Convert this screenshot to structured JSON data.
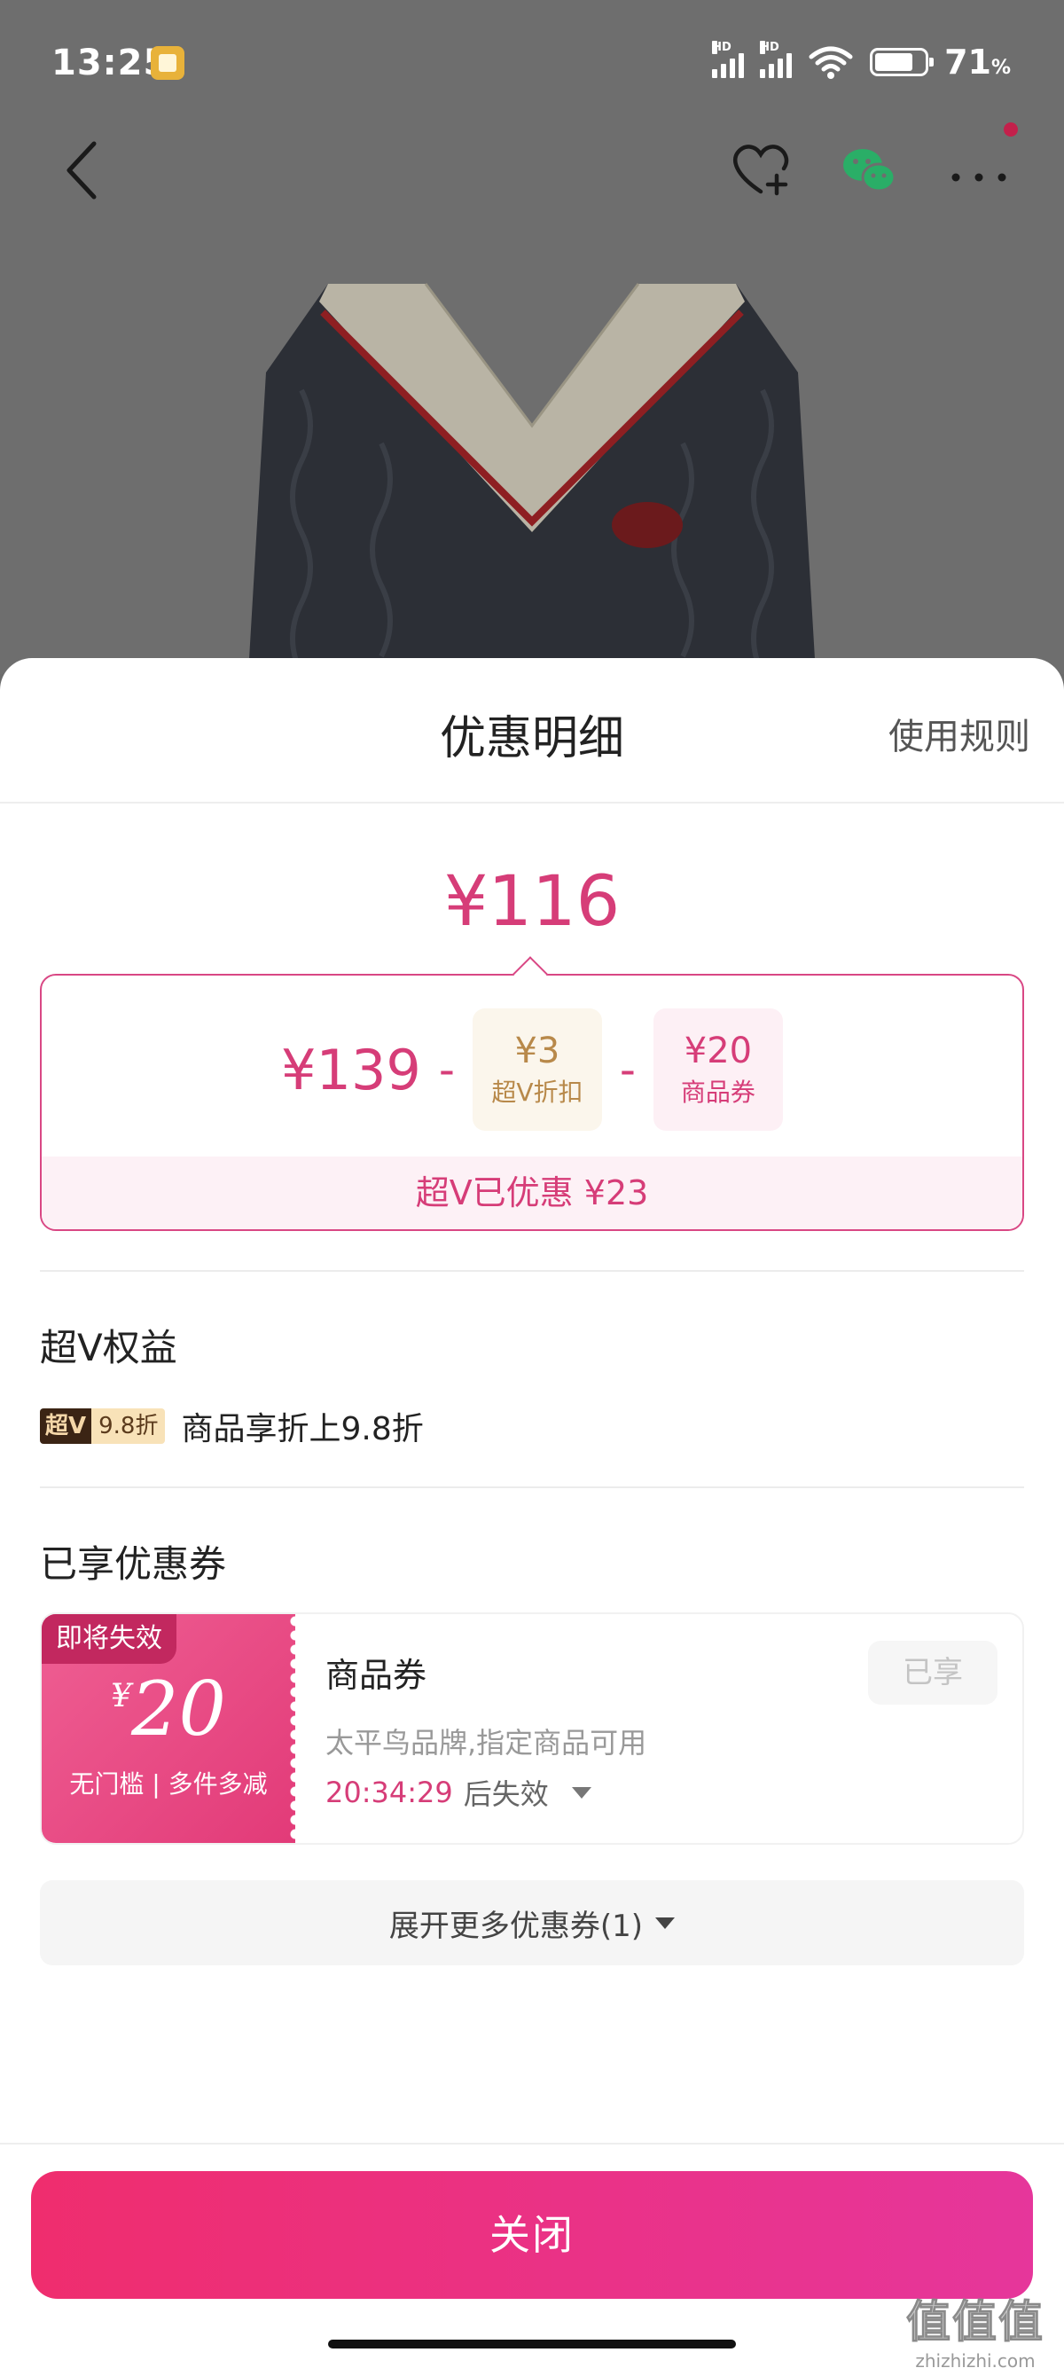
{
  "status_bar": {
    "time": "13:25",
    "signal_1_label": "HD",
    "signal_2_label": "HD",
    "battery_percent": "71",
    "battery_unit": "%",
    "icons": [
      "notification-icon",
      "signal-icon",
      "signal-icon",
      "wifi-icon",
      "battery-icon"
    ]
  },
  "nav": {
    "icons": [
      "back-icon",
      "favorite-add-icon",
      "wechat-icon",
      "more-icon"
    ],
    "wechat_color": "#2aae67",
    "badge_color": "#c3204b"
  },
  "sheet": {
    "title": "优惠明细",
    "rules_link": "使用规则",
    "final_price": "¥116",
    "calc": {
      "original_price": "¥139",
      "minus": "-",
      "discounts": [
        {
          "amount": "¥3",
          "label": "超V折扣"
        },
        {
          "amount": "¥20",
          "label": "商品券"
        }
      ],
      "summary": "超V已优惠 ¥23"
    },
    "benefits": {
      "title": "超V权益",
      "badge_left": "超V",
      "badge_right": "9.8折",
      "text": "商品享折上9.8折"
    },
    "coupons": {
      "title": "已享优惠券",
      "items": [
        {
          "tag": "即将失效",
          "currency": "¥",
          "amount": "20",
          "condition": "无门槛 | 多件多减",
          "name": "商品券",
          "description": "太平鸟品牌,指定商品可用",
          "countdown": "20:34:29",
          "countdown_suffix": "后失效",
          "status_button": "已享"
        }
      ],
      "expand_label": "展开更多优惠券(1)"
    },
    "close_button": "关闭"
  },
  "watermark": {
    "main": "值值值",
    "sub": "zhizhizhi.com"
  },
  "colors": {
    "accent": "#d63d78",
    "gold": "#b8894a",
    "close_gradient_start": "#ef2d6e",
    "close_gradient_end": "#e6369b"
  }
}
